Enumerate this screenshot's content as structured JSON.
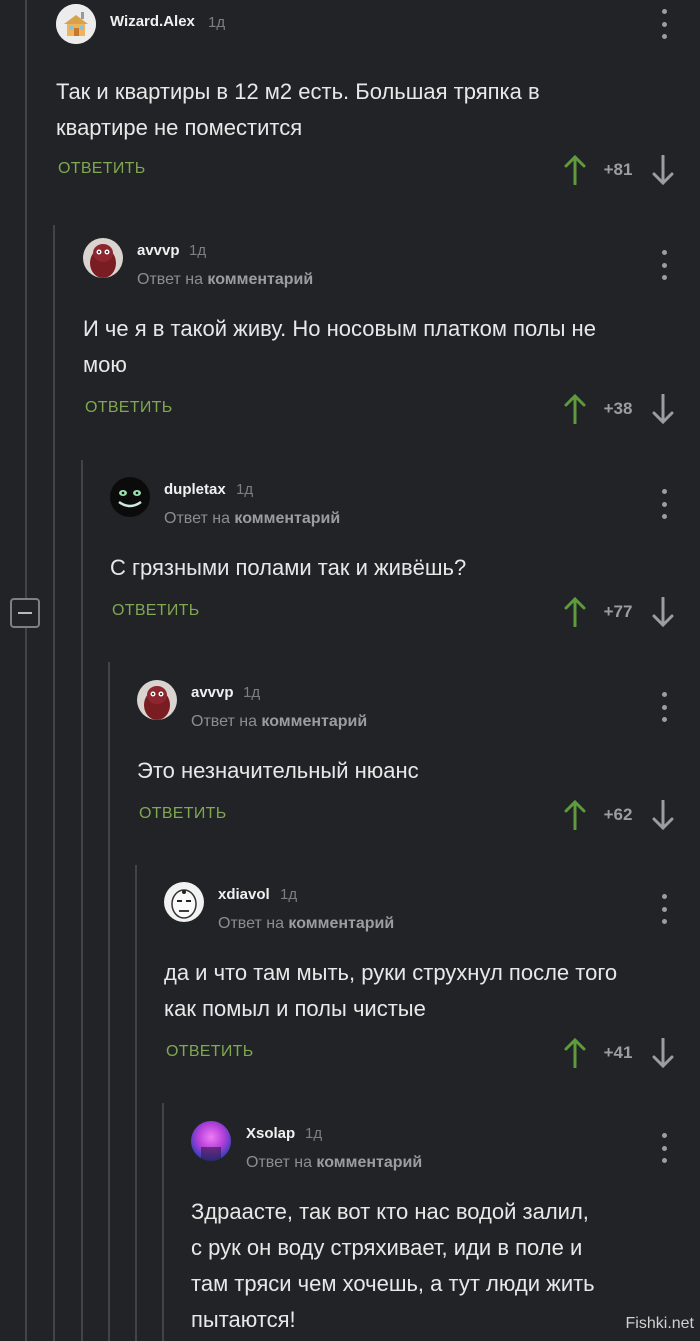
{
  "comments": [
    {
      "author": "Wizard.Alex",
      "time": "1д",
      "reply_prefix": "",
      "reply_target": "",
      "text_lines": [
        "Так и квартиры в 12 м2 есть. Большая тряпка в",
        "квартире не поместится"
      ],
      "reply_label": "ОТВЕТИТЬ",
      "score": "+81",
      "avatar": "house-avatar"
    },
    {
      "author": "avvvp",
      "time": "1д",
      "reply_prefix": "Ответ на",
      "reply_target": "комментарий",
      "text_lines": [
        "И че я в такой живу. Но носовым платком полы не",
        "мою"
      ],
      "reply_label": "ОТВЕТИТЬ",
      "score": "+38",
      "avatar": "creature-avatar"
    },
    {
      "author": "dupletax",
      "time": "1д",
      "reply_prefix": "Ответ на",
      "reply_target": "комментарий",
      "text_lines": [
        "С грязными полами так и живёшь?"
      ],
      "reply_label": "ОТВЕТИТЬ",
      "score": "+77",
      "avatar": "grin-avatar"
    },
    {
      "author": "avvvp",
      "time": "1д",
      "reply_prefix": "Ответ на",
      "reply_target": "комментарий",
      "text_lines": [
        "Это незначительный нюанс"
      ],
      "reply_label": "ОТВЕТИТЬ",
      "score": "+62",
      "avatar": "creature-avatar"
    },
    {
      "author": "xdiavol",
      "time": "1д",
      "reply_prefix": "Ответ на",
      "reply_target": "комментарий",
      "text_lines": [
        "да и что там мыть, руки струхнул после того",
        "как помыл и полы чистые"
      ],
      "reply_label": "ОТВЕТИТЬ",
      "score": "+41",
      "avatar": "face-avatar"
    },
    {
      "author": "Xsolap",
      "time": "1д",
      "reply_prefix": "Ответ на",
      "reply_target": "комментарий",
      "text_lines": [
        "Здрааcте, так вот кто нас водой залил,",
        "с рук он воду стряхивает, иди в поле и",
        "там тряси чем хочешь, а тут люди жить",
        "пытаются!"
      ],
      "reply_label": "",
      "score": "",
      "avatar": "purple-avatar"
    }
  ],
  "watermark": "Fishki.net",
  "colors": {
    "background": "#212326",
    "reply_green": "#7fa851",
    "upvote": "#5f9a3c",
    "downvote": "#9a9ea2"
  }
}
